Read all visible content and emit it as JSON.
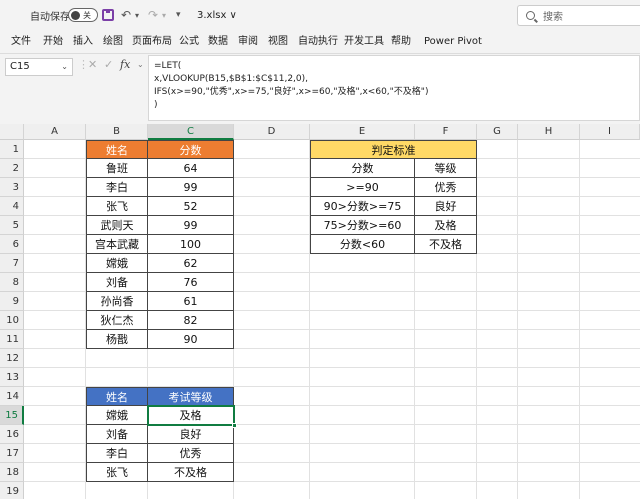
{
  "titlebar": {
    "autosave_label": "自动保存",
    "autosave_state": "关",
    "more_glyph": "▾",
    "filename": "3.xlsx ∨",
    "search_placeholder": "搜索"
  },
  "ribbon": {
    "tabs": [
      "文件",
      "开始",
      "插入",
      "绘图",
      "页面布局",
      "公式",
      "数据",
      "审阅",
      "视图",
      "自动执行",
      "开发工具",
      "帮助",
      "Power Pivot"
    ]
  },
  "formula_bar": {
    "name_box": "C15",
    "fx": "fx",
    "lines": [
      "=LET(",
      "x,VLOOKUP(B15,$B$1:$C$11,2,0),",
      "IFS(x>=90,\"优秀\",x>=75,\"良好\",x>=60,\"及格\",x<60,\"不及格\")",
      ")"
    ]
  },
  "grid": {
    "columns": [
      "A",
      "B",
      "C",
      "D",
      "E",
      "F",
      "G",
      "H",
      "I"
    ],
    "selected_column": "C",
    "rows": [
      "1",
      "2",
      "3",
      "4",
      "5",
      "6",
      "7",
      "8",
      "9",
      "10",
      "11",
      "12",
      "13",
      "14",
      "15",
      "16",
      "17",
      "18",
      "19"
    ],
    "selected_row": "15",
    "colors": {
      "blue": "#4472c4",
      "orange": "#ed7d31",
      "yellow": "#ffd966",
      "accent": "#107c41"
    }
  },
  "score_table": {
    "header_name": "姓名",
    "header_score": "分数",
    "rows": [
      {
        "name": "鲁班",
        "score": "64"
      },
      {
        "name": "李白",
        "score": "99"
      },
      {
        "name": "张飞",
        "score": "52"
      },
      {
        "name": "武则天",
        "score": "99"
      },
      {
        "name": "宫本武藏",
        "score": "100"
      },
      {
        "name": "嫦娥",
        "score": "62"
      },
      {
        "name": "刘备",
        "score": "76"
      },
      {
        "name": "孙尚香",
        "score": "61"
      },
      {
        "name": "狄仁杰",
        "score": "82"
      },
      {
        "name": "杨戬",
        "score": "90"
      }
    ]
  },
  "criteria_table": {
    "title": "判定标准",
    "header_score": "分数",
    "header_grade": "等级",
    "rows": [
      {
        "range": ">=90",
        "grade": "优秀"
      },
      {
        "range": "90>分数>=75",
        "grade": "良好"
      },
      {
        "range": "75>分数>=60",
        "grade": "及格"
      },
      {
        "range": "分数<60",
        "grade": "不及格"
      }
    ]
  },
  "result_table": {
    "header_name": "姓名",
    "header_grade": "考试等级",
    "rows": [
      {
        "name": "嫦娥",
        "grade": "及格"
      },
      {
        "name": "刘备",
        "grade": "良好"
      },
      {
        "name": "李白",
        "grade": "优秀"
      },
      {
        "name": "张飞",
        "grade": "不及格"
      }
    ]
  }
}
